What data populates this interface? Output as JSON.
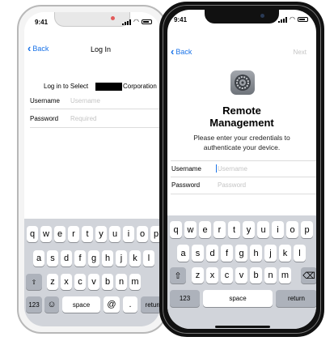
{
  "back_phone": {
    "status_time": "9:41",
    "nav": {
      "back_label": "Back",
      "title": "Log In"
    },
    "login_prompt": "Log in to Select",
    "company_suffix": "Corporation",
    "username": {
      "label": "Username",
      "placeholder": "Username"
    },
    "password": {
      "label": "Password",
      "placeholder": "Required"
    },
    "keyboard": {
      "row1": [
        "q",
        "w",
        "e",
        "r",
        "t",
        "y",
        "u",
        "i",
        "o",
        "p"
      ],
      "row2": [
        "a",
        "s",
        "d",
        "f",
        "g",
        "h",
        "j",
        "k",
        "l"
      ],
      "row3": [
        "z",
        "x",
        "c",
        "v",
        "b",
        "n",
        "m"
      ],
      "numbers_key": "123",
      "emoji_key": "☺",
      "space_key": "space",
      "at_key": "@",
      "dot_key": ".",
      "return_key": "return"
    }
  },
  "front_phone": {
    "status_time": "9:41",
    "nav": {
      "back_label": "Back",
      "next_label": "Next"
    },
    "title_line1": "Remote",
    "title_line2": "Management",
    "subtitle_line1": "Please  enter your credentials to",
    "subtitle_line2": "authenticate your device.",
    "username": {
      "label": "Username",
      "placeholder": "Username"
    },
    "password": {
      "label": "Password",
      "placeholder": "Password"
    },
    "keyboard": {
      "row1": [
        "q",
        "w",
        "e",
        "r",
        "t",
        "y",
        "u",
        "i",
        "o",
        "p"
      ],
      "row2": [
        "a",
        "s",
        "d",
        "f",
        "g",
        "h",
        "j",
        "k",
        "l"
      ],
      "row3": [
        "z",
        "x",
        "c",
        "v",
        "b",
        "n",
        "m"
      ],
      "shift_key": "⇧",
      "delete_key": "⌫",
      "numbers_key": "123",
      "space_key": "space",
      "return_key": "return"
    }
  },
  "colors": {
    "link_blue": "#1a73e8",
    "placeholder_gray": "#c4c4c4",
    "keyboard_bg": "#d1d4da"
  }
}
